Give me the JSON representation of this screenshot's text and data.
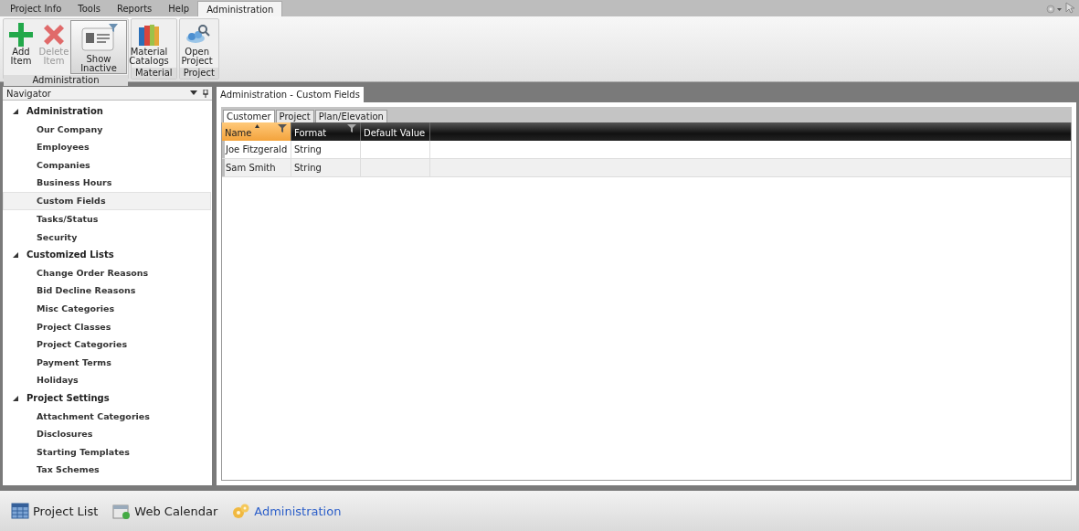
{
  "menu_tabs": [
    {
      "label": "Project Info",
      "selected": false
    },
    {
      "label": "Tools",
      "selected": false
    },
    {
      "label": "Reports",
      "selected": false
    },
    {
      "label": "Help",
      "selected": false
    },
    {
      "label": "Administration",
      "selected": true
    }
  ],
  "ribbon_groups": [
    {
      "label": "Administration",
      "buttons": [
        {
          "label": "Add Item",
          "disabled": false,
          "pressed": false
        },
        {
          "label": "Delete Item",
          "disabled": true,
          "pressed": false
        },
        {
          "label": "Show Inactive",
          "disabled": false,
          "pressed": true
        }
      ]
    },
    {
      "label": "Material",
      "buttons": [
        {
          "label": "Material Catalogs",
          "disabled": false,
          "pressed": false
        }
      ]
    },
    {
      "label": "Project",
      "buttons": [
        {
          "label": "Open Project",
          "disabled": false,
          "pressed": false
        }
      ]
    }
  ],
  "navigator": {
    "title": "Navigator",
    "tree": [
      {
        "label": "Administration",
        "expanded": true,
        "children": [
          {
            "label": "Our Company",
            "selected": false
          },
          {
            "label": "Employees",
            "selected": false
          },
          {
            "label": "Companies",
            "selected": false
          },
          {
            "label": "Business Hours",
            "selected": false
          },
          {
            "label": "Custom Fields",
            "selected": true
          },
          {
            "label": "Tasks/Status",
            "selected": false
          },
          {
            "label": "Security",
            "selected": false
          }
        ]
      },
      {
        "label": "Customized Lists",
        "expanded": true,
        "children": [
          {
            "label": "Change Order Reasons",
            "selected": false
          },
          {
            "label": "Bid Decline Reasons",
            "selected": false
          },
          {
            "label": "Misc Categories",
            "selected": false
          },
          {
            "label": "Project Classes",
            "selected": false
          },
          {
            "label": "Project Categories",
            "selected": false
          },
          {
            "label": "Payment Terms",
            "selected": false
          },
          {
            "label": "Holidays",
            "selected": false
          }
        ]
      },
      {
        "label": "Project Settings",
        "expanded": true,
        "children": [
          {
            "label": "Attachment Categories",
            "selected": false
          },
          {
            "label": "Disclosures",
            "selected": false
          },
          {
            "label": "Starting Templates",
            "selected": false
          },
          {
            "label": "Tax Schemes",
            "selected": false
          }
        ]
      }
    ]
  },
  "document_tab": "Administration - Custom Fields",
  "sub_tabs": [
    {
      "label": "Customer",
      "selected": true
    },
    {
      "label": "Project",
      "selected": false
    },
    {
      "label": "Plan/Elevation",
      "selected": false
    }
  ],
  "table": {
    "columns": [
      {
        "label": "Name",
        "sorted": true,
        "filter": true
      },
      {
        "label": "Format",
        "sorted": false,
        "filter": true
      },
      {
        "label": "Default Value",
        "sorted": false,
        "filter": false
      }
    ],
    "rows": [
      [
        "Joe Fitzgerald",
        "String",
        ""
      ],
      [
        "Sam Smith",
        "String",
        ""
      ]
    ]
  },
  "bottom_nav": [
    {
      "label": "Project List",
      "selected": false
    },
    {
      "label": "Web Calendar",
      "selected": false
    },
    {
      "label": "Administration",
      "selected": true
    }
  ]
}
